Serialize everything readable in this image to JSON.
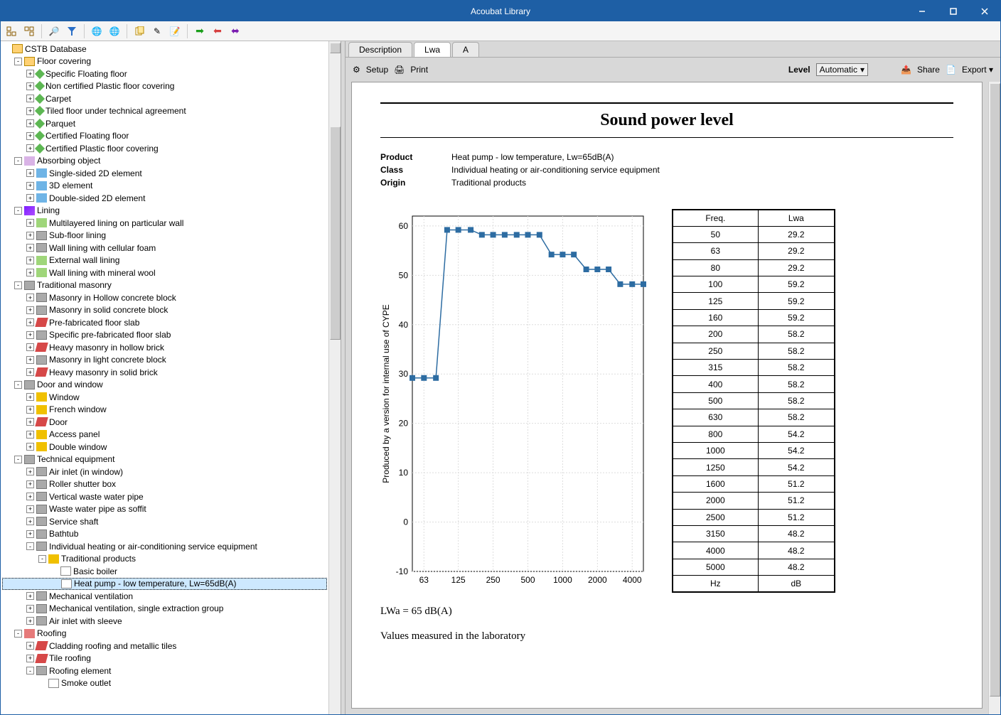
{
  "window": {
    "title": "Acoubat Library"
  },
  "toolbar": {
    "icons": [
      "tree-collapse-icon",
      "tree-expand-icon",
      "binoculars-icon",
      "filter-icon",
      "globe-icon",
      "globe2-icon",
      "copy-icon",
      "edit-icon",
      "note-icon",
      "arrow-right-icon",
      "arrow-left-icon",
      "arrow-both-icon"
    ]
  },
  "tree": {
    "root": "CSTB Database",
    "groups": [
      {
        "label": "Floor covering",
        "children": [
          "Specific Floating floor",
          "Non certified Plastic floor covering",
          "Carpet",
          "Tiled floor under technical agreement",
          "Parquet",
          "Certified Floating floor",
          "Certified Plastic floor covering"
        ]
      },
      {
        "label": "Absorbing object",
        "children": [
          "Single-sided 2D element",
          "3D element",
          "Double-sided 2D element"
        ]
      },
      {
        "label": "Lining",
        "children": [
          "Multilayered lining on particular wall",
          "Sub-floor lining",
          "Wall lining with cellular foam",
          "External wall lining",
          "Wall lining with mineral wool"
        ]
      },
      {
        "label": "Traditional masonry",
        "children": [
          "Masonry in Hollow concrete block",
          "Masonry in solid concrete block",
          "Pre-fabricated floor slab",
          "Specific pre-fabricated floor slab",
          "Heavy masonry in hollow brick",
          "Masonry in light concrete block",
          "Heavy masonry in solid brick"
        ]
      },
      {
        "label": "Door and window",
        "children": [
          "Window",
          "French window",
          "Door",
          "Access panel",
          "Double window"
        ]
      },
      {
        "label": "Technical equipment",
        "children": [
          "Air inlet (in window)",
          "Roller shutter box",
          "Vertical waste water pipe",
          "Waste water pipe as soffit",
          "Service shaft",
          "Bathtub",
          {
            "label": "Individual heating or air-conditioning service equipment",
            "open": true,
            "sub": [
              {
                "label": "Traditional products",
                "open": true,
                "leaves": [
                  "Basic boiler",
                  "Heat pump - low temperature, Lw=65dB(A)"
                ]
              }
            ]
          },
          "Mechanical ventilation",
          "Mechanical ventilation, single extraction group",
          "Air inlet with sleeve"
        ]
      },
      {
        "label": "Roofing",
        "children": [
          "Cladding roofing and metallic tiles",
          "Tile roofing",
          {
            "label": "Roofing element",
            "open": true,
            "leaves": [
              "Smoke outlet"
            ]
          }
        ]
      }
    ]
  },
  "tabs": [
    "Description",
    "Lwa",
    "A"
  ],
  "rbar": {
    "setup": "Setup",
    "print": "Print",
    "level_label": "Level",
    "level_value": "Automatic",
    "share": "Share",
    "export": "Export"
  },
  "report": {
    "title": "Sound power level",
    "fields": [
      [
        "Product",
        "Heat pump - low temperature, Lw=65dB(A)"
      ],
      [
        "Class",
        "Individual heating or air-conditioning service equipment"
      ],
      [
        "Origin",
        "Traditional products"
      ]
    ],
    "table_header": [
      "Freq.",
      "Lwa"
    ],
    "table_footer": [
      "Hz",
      "dB"
    ],
    "summary": "LWa = 65 dB(A)",
    "note": "Values measured in the laboratory",
    "ylabel": "Produced by a version for internal use of CYPE"
  },
  "chart_data": {
    "type": "line",
    "title": "Sound power level",
    "xlabel": "Hz",
    "ylabel": "dB",
    "ylim": [
      -10,
      62
    ],
    "x_ticks": [
      63,
      125,
      250,
      500,
      1000,
      2000,
      4000
    ],
    "freqs": [
      50,
      63,
      80,
      100,
      125,
      160,
      200,
      250,
      315,
      400,
      500,
      630,
      800,
      1000,
      1250,
      1600,
      2000,
      2500,
      3150,
      4000,
      5000
    ],
    "values": [
      29.2,
      29.2,
      29.2,
      59.2,
      59.2,
      59.2,
      58.2,
      58.2,
      58.2,
      58.2,
      58.2,
      58.2,
      54.2,
      54.2,
      54.2,
      51.2,
      51.2,
      51.2,
      48.2,
      48.2,
      48.2
    ]
  }
}
